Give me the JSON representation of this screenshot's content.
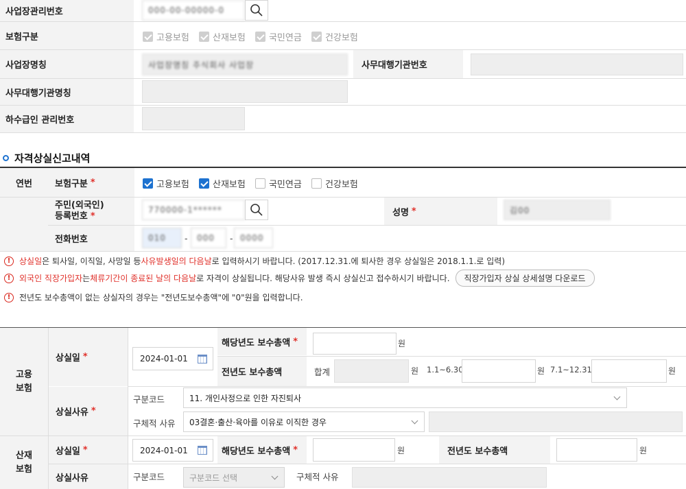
{
  "top": {
    "biz_no_label": "사업장관리번호",
    "biz_no_value": "000-00-00000-0",
    "ins_type_label": "보험구분",
    "ins_types": [
      "고용보험",
      "산재보험",
      "국민연금",
      "건강보험"
    ],
    "biz_name_label": "사업장명칭",
    "biz_name_value": "사업장명칭 주식회사 사업장",
    "agency_no_label": "사무대행기관번호",
    "agency_name_label": "사무대행기관명칭",
    "sub_no_label": "하수급인 관리번호"
  },
  "section": {
    "title": "자격상실신고내역",
    "col_no": "연번",
    "ins_type_label": "보험구분",
    "ins_types": [
      "고용보험",
      "산재보험",
      "국민연금",
      "건강보험"
    ],
    "rrn_label_1": "주민(외국인)",
    "rrn_label_2": "등록번호",
    "rrn_value": "770000-1******",
    "name_label": "성명",
    "name_value": "김00",
    "phone_label": "전화번호",
    "phone_1": "010",
    "phone_2": "000",
    "phone_3": "0000",
    "dash": "-"
  },
  "notes": {
    "n1_a": "상실일",
    "n1_b": "은 퇴사일, 이직일, 사망일 등 ",
    "n1_c": "사유발생일의 다음날",
    "n1_d": "로 입력하시기 바랍니다. (2017.12.31.에 퇴사한 경우 상실일은 2018.1.1.로 입력)",
    "n2_a": "외국인 직장가입자",
    "n2_b": "는 ",
    "n2_c": "체류기간이 종료된 날의 다음날",
    "n2_d": "로 자격이 상실됩니다. 해당사유 발생 즉시 상실신고 접수하시기 바랍니다.",
    "n2_btn": "직장가입자 상실 상세설명 다운로드",
    "n3": "전년도 보수총액이 없는 상실자의 경우는 \"전년도보수총액\"에 \"0\"원을 입력합니다."
  },
  "employment": {
    "group_1": "고용",
    "group_2": "보험",
    "loss_date_label": "상실일",
    "loss_date_value": "2024-01-01",
    "cur_total_label": "해당년도 보수총액",
    "prev_total_label": "전년도 보수총액",
    "sum_label": "합계",
    "won": "원",
    "h1_label": "1.1~6.30",
    "h2_label": "7.1~12.31",
    "reason_label": "상실사유",
    "code_label": "구분코드",
    "code_value": "11. 개인사정으로 인한 자진퇴사",
    "detail_label": "구체적 사유",
    "detail_value": "03결혼·출산·육아를 이유로 이직한 경우"
  },
  "industrial": {
    "group_1": "산재",
    "group_2": "보험",
    "loss_date_label": "상실일",
    "loss_date_value": "2024-01-01",
    "cur_total_label": "해당년도 보수총액",
    "prev_total_label": "전년도 보수총액",
    "won": "원",
    "reason_label": "상실사유",
    "code_label": "구분코드",
    "code_placeholder": "구분코드 선택",
    "detail_label": "구체적 사유"
  },
  "colors": {
    "accent": "#1d72d0",
    "required": "#e0312b",
    "label_bg": "#f3f3f3"
  }
}
